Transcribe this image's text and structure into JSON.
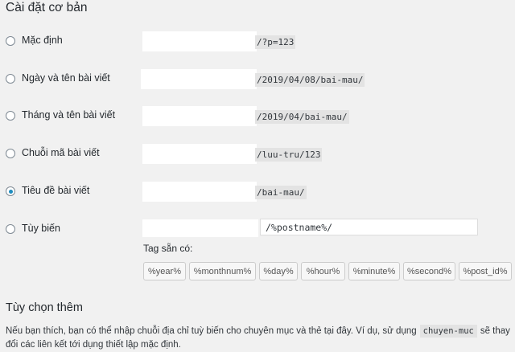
{
  "section_title": "Cài đặt cơ bản",
  "options": [
    {
      "label": "Mặc định",
      "structure": "/?p=123",
      "checked": false
    },
    {
      "label": "Ngày và tên bài viết",
      "structure": "/2019/04/08/bai-mau/",
      "checked": false
    },
    {
      "label": "Tháng và tên bài viết",
      "structure": "/2019/04/bai-mau/",
      "checked": false
    },
    {
      "label": "Chuỗi mã bài viết",
      "structure": "/luu-tru/123",
      "checked": false
    },
    {
      "label": "Tiêu đề bài viết",
      "structure": "/bai-mau/",
      "checked": true
    },
    {
      "label": "Tùy biến",
      "structure": "/%postname%/",
      "checked": false
    }
  ],
  "tags_label": "Tag sẵn có:",
  "tags": [
    "%year%",
    "%monthnum%",
    "%day%",
    "%hour%",
    "%minute%",
    "%second%",
    "%post_id%"
  ],
  "extra_title": "Tùy chọn thêm",
  "extra_text_before": "Nếu bạn thích, bạn có thể nhập chuỗi địa chỉ tuỳ biến cho chuyên mục và thẻ tại đây. Ví dụ, sử dụng",
  "extra_code": "chuyen-muc",
  "extra_text_after": "sẽ thay đổi các liên kết tới dụng thiết lập mặc định."
}
